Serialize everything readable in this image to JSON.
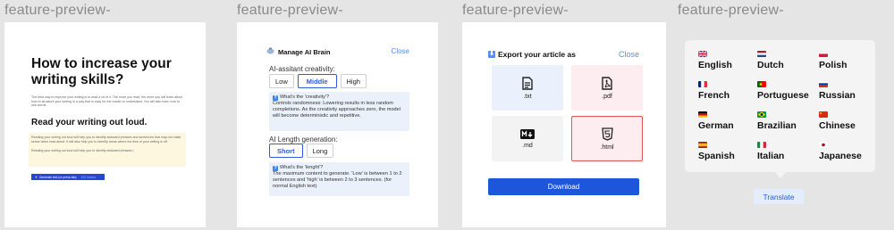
{
  "frames": [
    "feature-preview-",
    "feature-preview-",
    "feature-preview-",
    "feature-preview-"
  ],
  "writing": {
    "title": "How to increase your writing skills?",
    "intro": "The best way to improve your writing is to read a lot of it. The more you read, the more you will learn about how to structure your writing in a way that is easy for the reader to understand. You will also learn how to use words",
    "subtitle": "Read your writing out loud.",
    "highlight_1": "Reading your writing out loud will help you to identify awkward phrases and sentences that may not make sense when read aloud. It will also help you to identify areas where the flow of your writing is off.",
    "highlight_2": "Reading your writing out loud will help you to identify awkward phrases |",
    "button_label": "Generate text (or press tab)",
    "button_hint": "320 tokens"
  },
  "brain": {
    "title": "Manage AI Brain",
    "close": "Close",
    "creativity_label": "AI-assitant creativity:",
    "creativity_options": [
      "Low",
      "Middle",
      "High"
    ],
    "creativity_selected": "Middle",
    "creativity_info_title": "What's the 'creativity'?",
    "creativity_info_text": "Controls randomness: Lowering results in less random completions. As the creativity approaches zero, the model will become deterministic and repetitive.",
    "length_label": "AI Length generation:",
    "length_options": [
      "Short",
      "Long"
    ],
    "length_selected": "Short",
    "length_info_title": "What's the 'lenght'?",
    "length_info_text": "The maximum content to generate. 'Low' is between 1 to 2 sentences and 'high' is between 2 to 3 sentences. (for normal English text)"
  },
  "export": {
    "title": "Export your article as",
    "close": "Close",
    "formats": [
      {
        "label": ".txt",
        "icon": "txt-file-icon",
        "bg": "#eaf0fc"
      },
      {
        "label": ".pdf",
        "icon": "pdf-file-icon",
        "bg": "#fdecf0"
      },
      {
        "label": ".md",
        "icon": "markdown-icon",
        "bg": "#f3f3f3"
      },
      {
        "label": ".html",
        "icon": "html5-icon",
        "bg": "#fdecf0",
        "selected_border": "#e05555"
      }
    ],
    "download": "Download",
    "accent": "#1d56da"
  },
  "translate": {
    "languages": [
      {
        "name": "English",
        "flag": "uk-flag-icon"
      },
      {
        "name": "Dutch",
        "flag": "netherlands-flag-icon"
      },
      {
        "name": "Polish",
        "flag": "poland-flag-icon"
      },
      {
        "name": "French",
        "flag": "france-flag-icon"
      },
      {
        "name": "Portuguese",
        "flag": "portugal-flag-icon"
      },
      {
        "name": "Russian",
        "flag": "russia-flag-icon"
      },
      {
        "name": "German",
        "flag": "germany-flag-icon"
      },
      {
        "name": "Brazilian",
        "flag": "brazil-flag-icon"
      },
      {
        "name": "Chinese",
        "flag": "china-flag-icon"
      },
      {
        "name": "Spanish",
        "flag": "spain-flag-icon"
      },
      {
        "name": "Italian",
        "flag": "italy-flag-icon"
      },
      {
        "name": "Japanese",
        "flag": "japan-flag-icon"
      }
    ],
    "button": "Translate"
  }
}
